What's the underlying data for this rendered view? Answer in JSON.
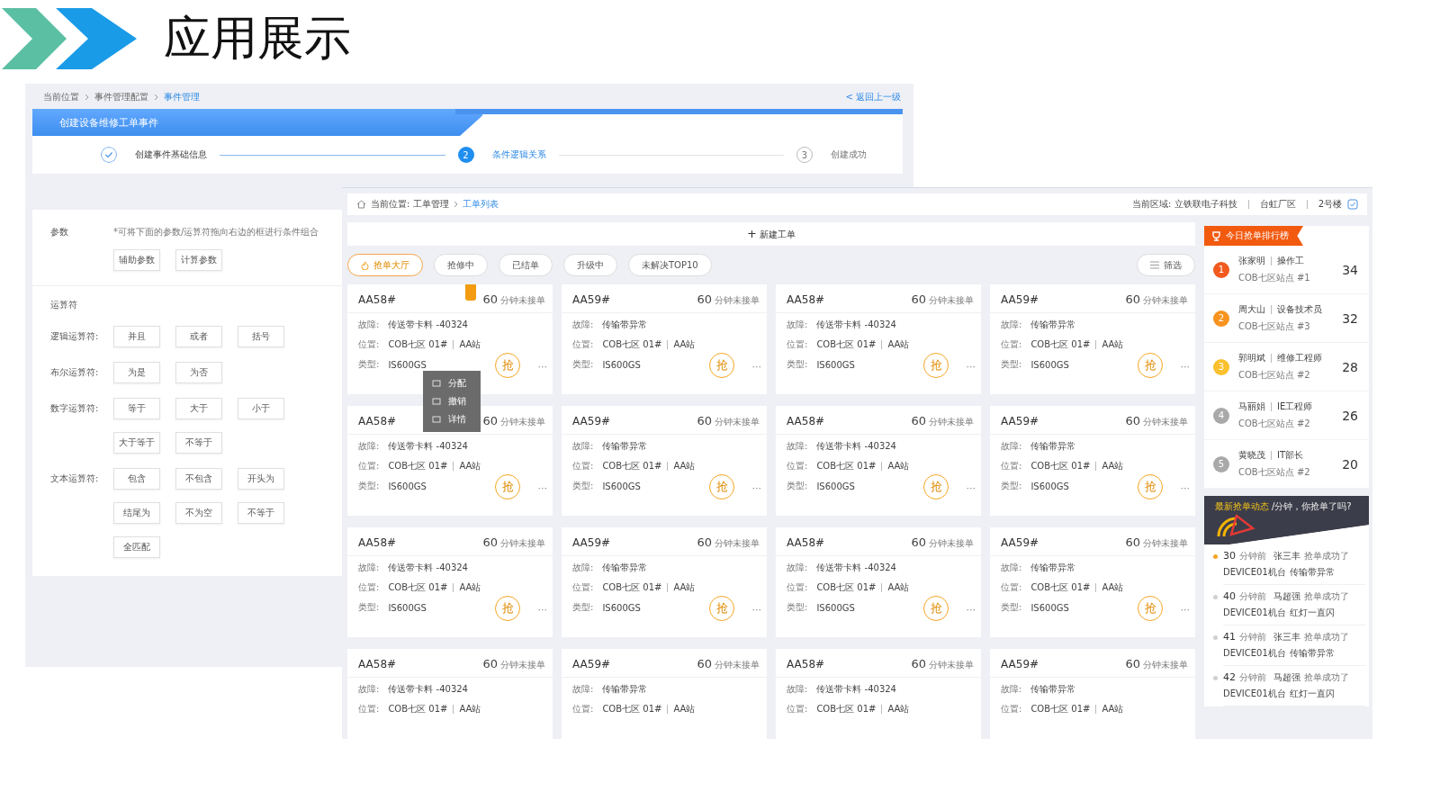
{
  "slide": {
    "title": "应用展示"
  },
  "back_window": {
    "breadcrumb": [
      {
        "label": "当前位置",
        "current": false
      },
      {
        "label": "事件管理配置",
        "current": false
      },
      {
        "label": "事件管理",
        "current": true
      }
    ],
    "back_link": "< 返回上一级",
    "header": "创建设备维修工单事件",
    "steps": [
      {
        "label": "创建事件基础信息",
        "done": true,
        "selected": false
      },
      {
        "number": "2",
        "label": "条件逻辑关系",
        "done": false,
        "selected": true
      },
      {
        "number": "3",
        "label": "创建成功",
        "done": false,
        "selected": false
      }
    ],
    "params": {
      "label": "参数",
      "hint": "*可将下面的参数/运算符拖向右边的框进行条件组合",
      "buttons": [
        "辅助参数",
        "计算参数"
      ]
    },
    "operators_title": "运算符",
    "operators": [
      {
        "label": "逻辑运算符:",
        "buttons": [
          "并且",
          "或者",
          "括号"
        ]
      },
      {
        "label": "布尔运算符:",
        "buttons": [
          "为是",
          "为否"
        ]
      },
      {
        "label": "数字运算符:",
        "buttons": [
          "等于",
          "大于",
          "小于",
          "大于等于",
          "不等于"
        ]
      },
      {
        "label": "文本运算符:",
        "buttons": [
          "包含",
          "不包含",
          "开头为",
          "结尾为",
          "不为空",
          "不等于",
          "全匹配"
        ]
      }
    ]
  },
  "front_window": {
    "breadcrumb_prefix": "当前位置: 工单管理",
    "breadcrumb_current": "工单列表",
    "area": [
      "当前区域: 立铁联电子科技",
      "台虹厂区",
      "2号楼"
    ],
    "new_button": {
      "icon": "+",
      "label": "新建工单"
    },
    "tabs": [
      {
        "label": "抢单大厅",
        "selected": true
      },
      {
        "label": "抢修中",
        "selected": false
      },
      {
        "label": "已结单",
        "selected": false
      },
      {
        "label": "升级中",
        "selected": false
      },
      {
        "label": "未解决TOP10",
        "selected": false
      }
    ],
    "filter": "筛选",
    "cards": [
      {
        "title": "AA58#",
        "minutes": "60",
        "unit": "分钟未接单",
        "fault": [
          "故障:",
          "传送带卡料 -40324"
        ],
        "location": [
          "位置:",
          "COB七区 01#",
          "AA站"
        ],
        "type": [
          "类型:",
          "IS600GS"
        ],
        "grab": "抢",
        "more": "···",
        "flagged": true
      },
      {
        "title": "AA59#",
        "minutes": "60",
        "unit": "分钟未接单",
        "fault": [
          "故障:",
          "传输带异常"
        ],
        "location": [
          "位置:",
          "COB七区 01#",
          "AA站"
        ],
        "type": [
          "类型:",
          "IS600GS"
        ],
        "grab": "抢",
        "more": "···",
        "flagged": false
      },
      {
        "title": "AA58#",
        "minutes": "60",
        "unit": "分钟未接单",
        "fault": [
          "故障:",
          "传送带卡料 -40324"
        ],
        "location": [
          "位置:",
          "COB七区 01#",
          "AA站"
        ],
        "type": [
          "类型:",
          "IS600GS"
        ],
        "grab": "抢",
        "more": "···",
        "flagged": false
      },
      {
        "title": "AA59#",
        "minutes": "60",
        "unit": "分钟未接单",
        "fault": [
          "故障:",
          "传输带异常"
        ],
        "location": [
          "位置:",
          "COB七区 01#",
          "AA站"
        ],
        "type": [
          "类型:",
          "IS600GS"
        ],
        "grab": "抢",
        "more": "···",
        "flagged": false
      },
      {
        "title": "AA58#",
        "minutes": "60",
        "unit": "分钟未接单",
        "fault": [
          "故障:",
          "传送带卡料 -40324"
        ],
        "location": [
          "位置:",
          "COB七区 01#",
          "AA站"
        ],
        "type": [
          "类型:",
          "IS600GS"
        ],
        "grab": "抢",
        "more": "···",
        "flagged": false
      },
      {
        "title": "AA59#",
        "minutes": "60",
        "unit": "分钟未接单",
        "fault": [
          "故障:",
          "传输带异常"
        ],
        "location": [
          "位置:",
          "COB七区 01#",
          "AA站"
        ],
        "type": [
          "类型:",
          "IS600GS"
        ],
        "grab": "抢",
        "more": "···",
        "flagged": false
      },
      {
        "title": "AA58#",
        "minutes": "60",
        "unit": "分钟未接单",
        "fault": [
          "故障:",
          "传送带卡料 -40324"
        ],
        "location": [
          "位置:",
          "COB七区 01#",
          "AA站"
        ],
        "type": [
          "类型:",
          "IS600GS"
        ],
        "grab": "抢",
        "more": "···",
        "flagged": false
      },
      {
        "title": "AA59#",
        "minutes": "60",
        "unit": "分钟未接单",
        "fault": [
          "故障:",
          "传输带异常"
        ],
        "location": [
          "位置:",
          "COB七区 01#",
          "AA站"
        ],
        "type": [
          "类型:",
          "IS600GS"
        ],
        "grab": "抢",
        "more": "···",
        "flagged": false
      },
      {
        "title": "AA58#",
        "minutes": "60",
        "unit": "分钟未接单",
        "fault": [
          "故障:",
          "传送带卡料 -40324"
        ],
        "location": [
          "位置:",
          "COB七区 01#",
          "AA站"
        ],
        "type": [
          "类型:",
          "IS600GS"
        ],
        "grab": "抢",
        "more": "···",
        "flagged": false
      },
      {
        "title": "AA59#",
        "minutes": "60",
        "unit": "分钟未接单",
        "fault": [
          "故障:",
          "传输带异常"
        ],
        "location": [
          "位置:",
          "COB七区 01#",
          "AA站"
        ],
        "type": [
          "类型:",
          "IS600GS"
        ],
        "grab": "抢",
        "more": "···",
        "flagged": false
      },
      {
        "title": "AA58#",
        "minutes": "60",
        "unit": "分钟未接单",
        "fault": [
          "故障:",
          "传送带卡料 -40324"
        ],
        "location": [
          "位置:",
          "COB七区 01#",
          "AA站"
        ],
        "type": [
          "类型:",
          "IS600GS"
        ],
        "grab": "抢",
        "more": "···",
        "flagged": false
      },
      {
        "title": "AA59#",
        "minutes": "60",
        "unit": "分钟未接单",
        "fault": [
          "故障:",
          "传输带异常"
        ],
        "location": [
          "位置:",
          "COB七区 01#",
          "AA站"
        ],
        "type": [
          "类型:",
          "IS600GS"
        ],
        "grab": "抢",
        "more": "···",
        "flagged": false
      },
      {
        "title": "AA58#",
        "minutes": "60",
        "unit": "分钟未接单",
        "fault": [
          "故障:",
          "传送带卡料 -40324"
        ],
        "location": [
          "位置:",
          "COB七区 01#",
          "AA站"
        ],
        "flagged": false
      },
      {
        "title": "AA59#",
        "minutes": "60",
        "unit": "分钟未接单",
        "fault": [
          "故障:",
          "传输带异常"
        ],
        "location": [
          "位置:",
          "COB七区 01#",
          "AA站"
        ],
        "flagged": false
      },
      {
        "title": "AA58#",
        "minutes": "60",
        "unit": "分钟未接单",
        "fault": [
          "故障:",
          "传送带卡料 -40324"
        ],
        "location": [
          "位置:",
          "COB七区 01#",
          "AA站"
        ],
        "flagged": false
      },
      {
        "title": "AA59#",
        "minutes": "60",
        "unit": "分钟未接单",
        "fault": [
          "故障:",
          "传输带异常"
        ],
        "location": [
          "位置:",
          "COB七区 01#",
          "AA站"
        ],
        "flagged": false
      }
    ],
    "card_menu": [
      "分配",
      "撤销",
      "详情"
    ],
    "ranking": {
      "title": "今日抢单排行榜",
      "items": [
        {
          "rank": "1",
          "name": "张家明",
          "role": "操作工",
          "site": "COB七区站点 #1",
          "count": "34",
          "color": "#f25a1e"
        },
        {
          "rank": "2",
          "name": "周大山",
          "role": "设备技术员",
          "site": "COB七区站点 #3",
          "count": "32",
          "color": "#f7931e"
        },
        {
          "rank": "3",
          "name": "郭明斌",
          "role": "维修工程师",
          "site": "COB七区站点 #2",
          "count": "28",
          "color": "#fbc02d"
        },
        {
          "rank": "4",
          "name": "马丽娟",
          "role": "IE工程师",
          "site": "COB七区站点 #2",
          "count": "26",
          "color": "#a9a9a9"
        },
        {
          "rank": "5",
          "name": "黄晓茂",
          "role": "IT部长",
          "site": "COB七区站点 #2",
          "count": "20",
          "color": "#a9a9a9"
        }
      ]
    },
    "feed": {
      "title": "最新抢单动态",
      "subtitle": "/分钟，你抢单了吗?",
      "items": [
        {
          "minutes": "30",
          "unit": "分钟前",
          "name": "张三丰",
          "action": "抢单成功了",
          "device": "DEVICE01机台",
          "fault": "传输带异常",
          "highlighted": true
        },
        {
          "minutes": "40",
          "unit": "分钟前",
          "name": "马超强",
          "action": "抢单成功了",
          "device": "DEVICE01机台",
          "fault": "红灯一直闪",
          "highlighted": false
        },
        {
          "minutes": "41",
          "unit": "分钟前",
          "name": "张三丰",
          "action": "抢单成功了",
          "device": "DEVICE01机台",
          "fault": "传输带异常",
          "highlighted": false
        },
        {
          "minutes": "42",
          "unit": "分钟前",
          "name": "马超强",
          "action": "抢单成功了",
          "device": "DEVICE01机台",
          "fault": "红灯一直闪",
          "highlighted": false
        }
      ]
    }
  }
}
